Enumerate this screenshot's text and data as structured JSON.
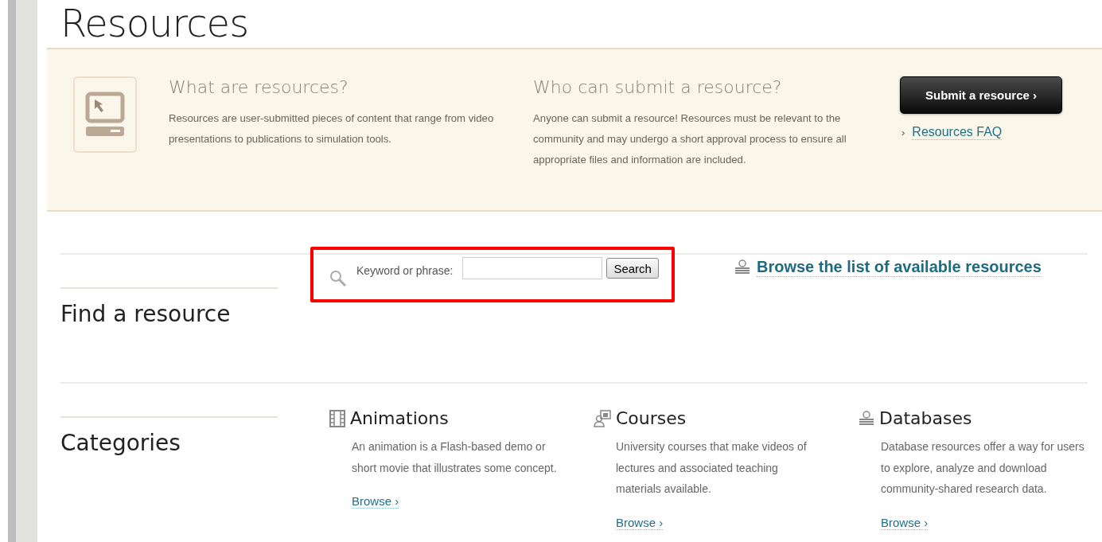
{
  "page_title": "Resources",
  "intro": {
    "blocks": [
      {
        "heading": "What are resources?",
        "text": "Resources are user-submitted pieces of content that range from video presentations to publications to simulation tools."
      },
      {
        "heading": "Who can submit a resource?",
        "text": "Anyone can submit a resource! Resources must be relevant to the community and may undergo a short approval process to ensure all appropriate files and information are included."
      }
    ],
    "submit_button": "Submit a resource ›",
    "faq_marker": "›",
    "faq_link": "Resources FAQ"
  },
  "find": {
    "heading": "Find a resource",
    "search_label": "Keyword or phrase:",
    "search_button": "Search",
    "highlighted": true,
    "browse_link": "Browse the list of available resources"
  },
  "categories": {
    "heading": "Categories",
    "items": [
      {
        "kind": "film",
        "title": "Animations",
        "text": "An animation is a Flash-based demo or short movie that illustrates some concept.",
        "link": "Browse ›"
      },
      {
        "kind": "people",
        "title": "Courses",
        "text": "University courses that make videos of lectures and associated teaching materials available.",
        "link": "Browse ›"
      },
      {
        "kind": "stack",
        "title": "Databases",
        "text": "Database resources offer a way for users to explore, analyze and download community-shared research data.",
        "link": "Browse ›"
      }
    ]
  }
}
